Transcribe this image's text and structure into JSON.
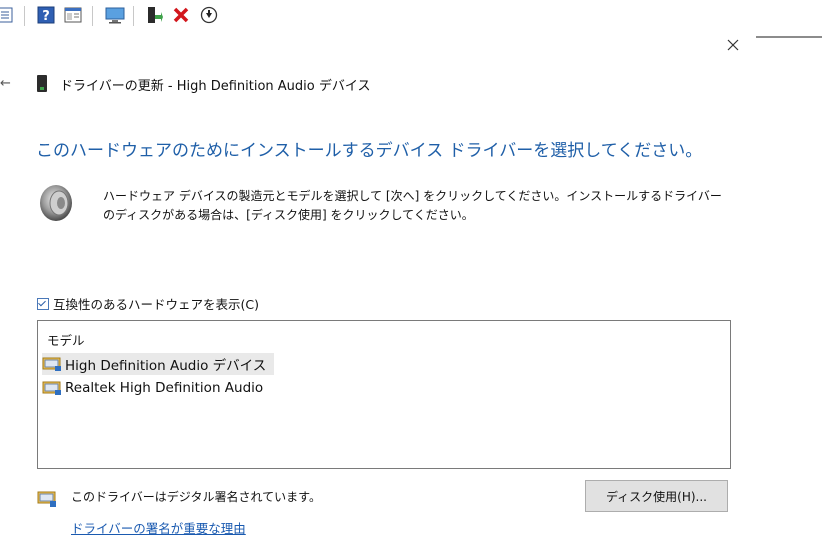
{
  "toolbar": {
    "icons": [
      "properties-icon",
      "help-icon",
      "console-icon",
      "computer-icon",
      "update-driver-icon",
      "uninstall-icon",
      "download-icon"
    ]
  },
  "dialog": {
    "title": "ドライバーの更新 - High Definition Audio デバイス",
    "heading": "このハードウェアのためにインストールするデバイス ドライバーを選択してください。",
    "description": "ハードウェア デバイスの製造元とモデルを選択して [次へ] をクリックしてください。インストールするドライバーのディスクがある場合は、[ディスク使用] をクリックしてください。",
    "compat_label": "互換性のあるハードウェアを表示(C)",
    "compat_checked": true,
    "list": {
      "header": "モデル",
      "items": [
        {
          "label": "High Definition Audio デバイス",
          "selected": true
        },
        {
          "label": "Realtek High Definition Audio",
          "selected": false
        }
      ]
    },
    "signed_text": "このドライバーはデジタル署名されています。",
    "signed_link": "ドライバーの署名が重要な理由",
    "disk_button": "ディスク使用(H)..."
  },
  "colors": {
    "heading": "#1f5fa8",
    "link": "#1a5ab0",
    "button_bg": "#e1e1e1",
    "selected_row": "#e9e9e9"
  }
}
